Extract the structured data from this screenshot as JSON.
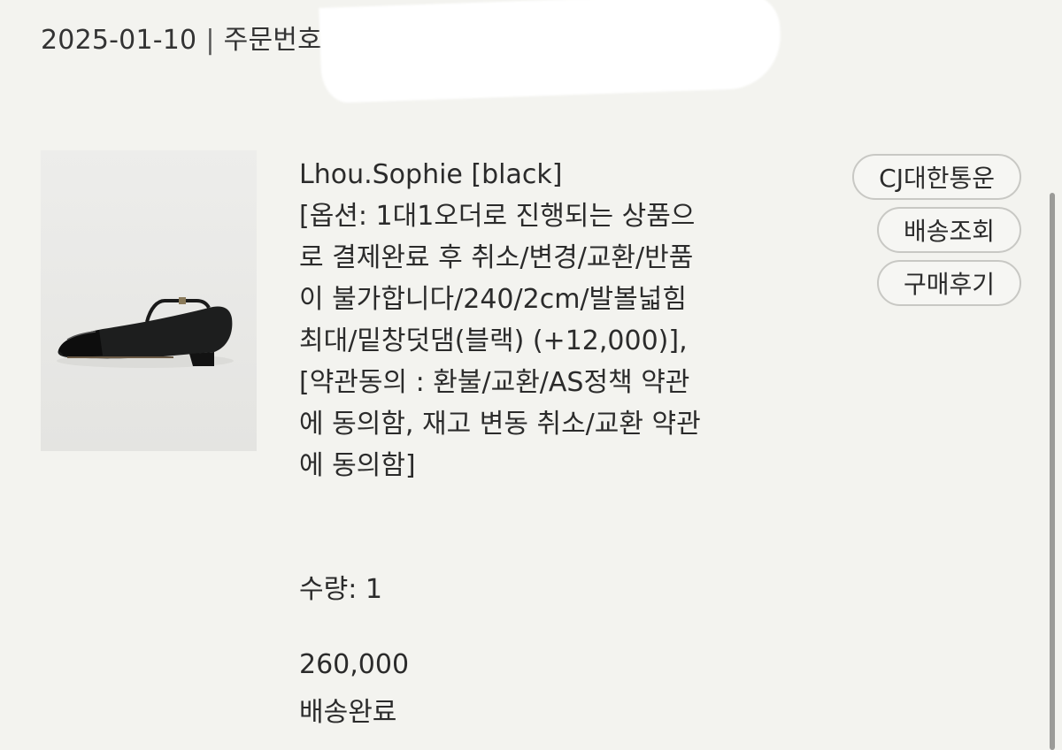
{
  "order": {
    "date": "2025-01-10",
    "separator": "|",
    "order_number_label": "주문번호"
  },
  "product": {
    "image_alt": "black mary jane flat shoe",
    "name": "Lhou.Sophie [black]",
    "option_lines": [
      "[옵션: 1대1오더로 진행되는 상품으",
      "로 결제완료 후 취소/변경/교환/반품",
      "이 불가합니다/240/2cm/발볼넓힘",
      "최대/밑창덧댐(블랙) (+12,000)],",
      "[약관동의 : 환불/교환/AS정책 약관",
      "에 동의함, 재고 변동 취소/교환 약관",
      "에 동의함]"
    ],
    "quantity_text": "수량: 1",
    "price": "260,000",
    "status": "배송완료"
  },
  "actions": {
    "courier_label": "CJ대한통운",
    "tracking_label": "배송조회",
    "review_label": "구매후기"
  },
  "colors": {
    "background": "#f3f3ef",
    "button_border": "#c8c8c4",
    "text": "#2b2b2b"
  }
}
